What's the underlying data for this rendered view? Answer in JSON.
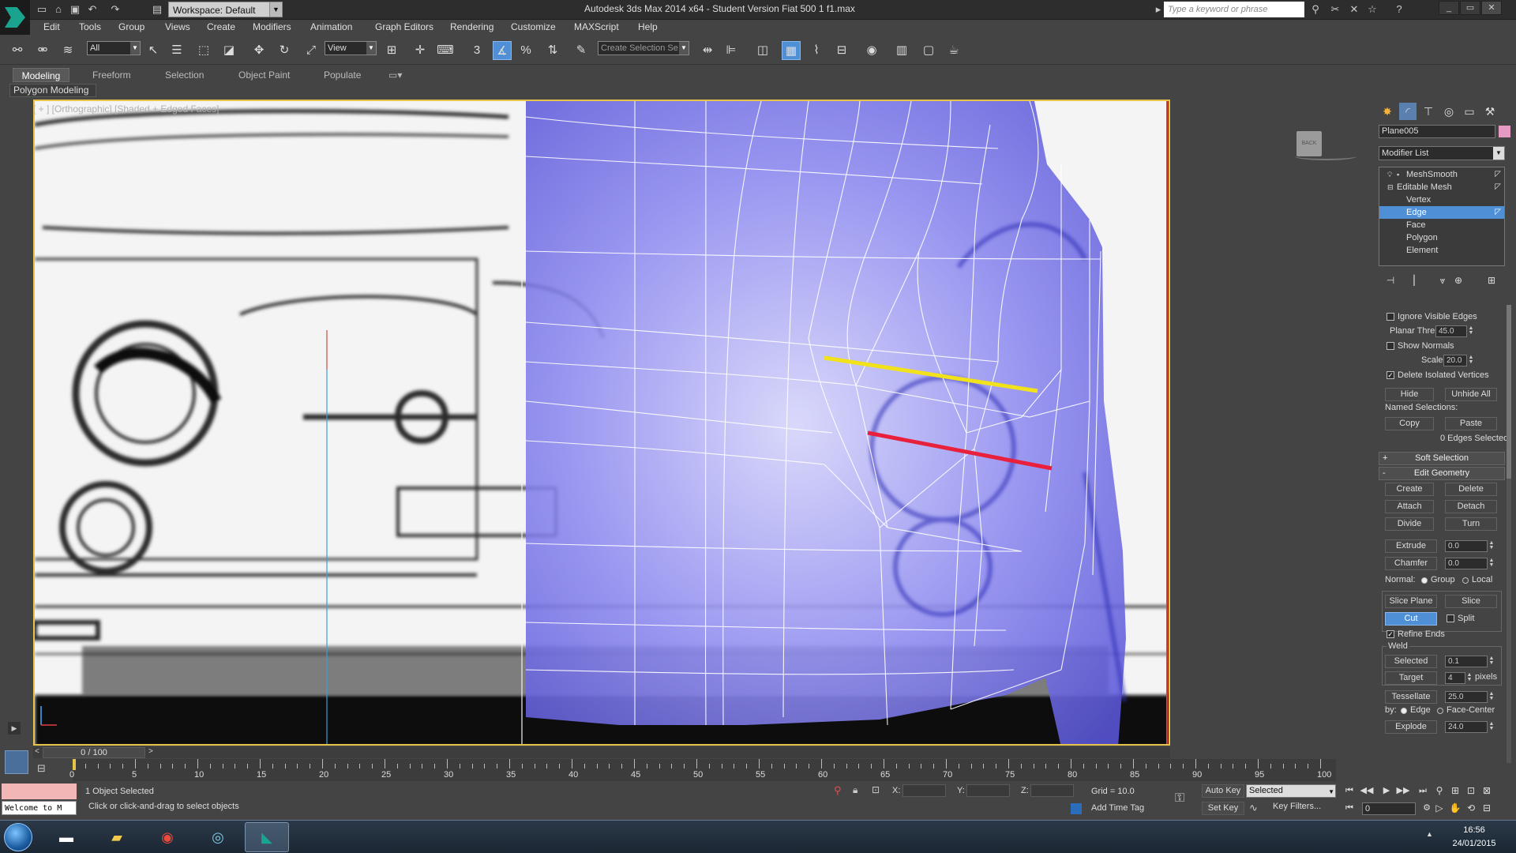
{
  "titlebar": {
    "workspace_label": "Workspace: Default",
    "app_title": "Autodesk 3ds Max  2014 x64   -  Student Version     Fiat 500 1 f1.max",
    "search_placeholder": "Type a keyword or phrase"
  },
  "menu": [
    "Edit",
    "Tools",
    "Group",
    "Views",
    "Create",
    "Modifiers",
    "Animation",
    "Graph Editors",
    "Rendering",
    "Customize",
    "MAXScript",
    "Help"
  ],
  "toolbar": {
    "selection_filter": "All",
    "reference_coord": "View",
    "named_selection_placeholder": "Create Selection Se",
    "snap_count": "3"
  },
  "ribbon": {
    "tabs": [
      "Modeling",
      "Freeform",
      "Selection",
      "Object Paint",
      "Populate"
    ],
    "active_tab": "Modeling",
    "panel_label": "Polygon Modeling"
  },
  "viewport": {
    "label": "[ + ] [Orthographic] [Shaded + Edged Faces]",
    "viewcube_label": "BACK"
  },
  "command_panel": {
    "object_name": "Plane005",
    "object_color": "#e59ac4",
    "modifier_list_label": "Modifier List",
    "stack": [
      {
        "label": "MeshSmooth",
        "level": 0
      },
      {
        "label": "Editable Mesh",
        "level": 0
      },
      {
        "label": "Vertex",
        "level": 1
      },
      {
        "label": "Edge",
        "level": 1,
        "selected": true
      },
      {
        "label": "Face",
        "level": 1
      },
      {
        "label": "Polygon",
        "level": 1
      },
      {
        "label": "Element",
        "level": 1
      }
    ],
    "selection": {
      "ignore_visible_edges": "Ignore Visible Edges",
      "planar_thresh_label": "Planar Thresh:",
      "planar_thresh_value": "45.0",
      "show_normals": "Show Normals",
      "scale_label": "Scale:",
      "scale_value": "20.0",
      "delete_isolated": "Delete Isolated Vertices",
      "hide": "Hide",
      "unhide_all": "Unhide All",
      "named_selections": "Named Selections:",
      "copy": "Copy",
      "paste": "Paste",
      "status": "0 Edges Selected"
    },
    "soft_selection": "Soft Selection",
    "edit_geometry": {
      "header": "Edit Geometry",
      "create": "Create",
      "delete": "Delete",
      "attach": "Attach",
      "detach": "Detach",
      "divide": "Divide",
      "turn": "Turn",
      "extrude": "Extrude",
      "extrude_value": "0.0",
      "chamfer": "Chamfer",
      "chamfer_value": "0.0",
      "normal_label": "Normal:",
      "group": "Group",
      "local": "Local",
      "slice_plane": "Slice Plane",
      "slice": "Slice",
      "cut": "Cut",
      "split": "Split",
      "refine_ends": "Refine Ends",
      "weld": "Weld",
      "selected": "Selected",
      "selected_value": "0.1",
      "target": "Target",
      "target_value": "4",
      "pixels": "pixels",
      "tessellate": "Tessellate",
      "tessellate_value": "25.0",
      "by_label": "by:",
      "edge": "Edge",
      "face_center": "Face-Center",
      "explode": "Explode",
      "explode_value": "24.0"
    }
  },
  "timeline": {
    "slider_label": "0 / 100",
    "ticks": [
      "0",
      "5",
      "10",
      "15",
      "20",
      "25",
      "30",
      "35",
      "40",
      "45",
      "50",
      "55",
      "60",
      "65",
      "70",
      "75",
      "80",
      "85",
      "90",
      "95",
      "100"
    ]
  },
  "status": {
    "maxscript_text": "Welcome to M",
    "object_selected": "1 Object Selected",
    "prompt": "Click or click-and-drag to select objects",
    "x_label": "X:",
    "y_label": "Y:",
    "z_label": "Z:",
    "grid": "Grid = 10.0",
    "add_time_tag": "Add Time Tag",
    "auto_key": "Auto Key",
    "set_key": "Set Key",
    "selected_dropdown": "Selected",
    "key_filters": "Key Filters...",
    "frame": "0"
  },
  "taskbar": {
    "time": "16:56",
    "date": "24/01/2015"
  },
  "colors": {
    "active_blue": "#4f8fd6",
    "viewport_border": "#e8c34a",
    "mesh_fill": "#7b78e8",
    "yellow_edge": "#f2e21c",
    "red_edge": "#e8203c"
  }
}
